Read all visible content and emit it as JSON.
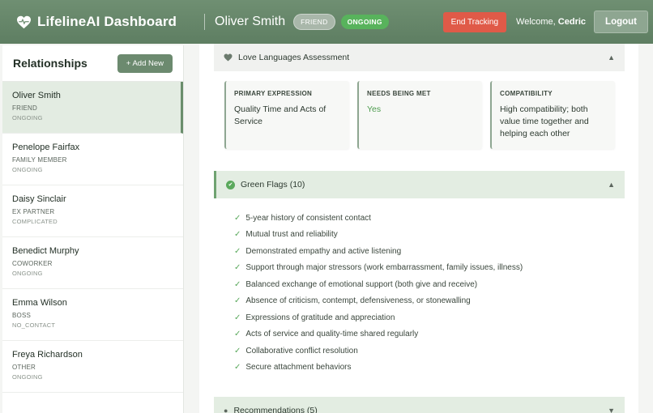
{
  "header": {
    "title": "LifelineAI Dashboard",
    "contact_name": "Oliver Smith",
    "relation_badge": "FRIEND",
    "status_badge": "ONGOING",
    "end_tracking_label": "End Tracking",
    "welcome_prefix": "Welcome, ",
    "user_name": "Cedric",
    "logout_label": "Logout"
  },
  "sidebar": {
    "title": "Relationships",
    "add_label": "+ Add New",
    "items": [
      {
        "name": "Oliver Smith",
        "type": "FRIEND",
        "status": "ONGOING"
      },
      {
        "name": "Penelope Fairfax",
        "type": "FAMILY MEMBER",
        "status": "ONGOING"
      },
      {
        "name": "Daisy Sinclair",
        "type": "EX PARTNER",
        "status": "COMPLICATED"
      },
      {
        "name": "Benedict Murphy",
        "type": "COWORKER",
        "status": "ONGOING"
      },
      {
        "name": "Emma Wilson",
        "type": "BOSS",
        "status": "NO_CONTACT"
      },
      {
        "name": "Freya Richardson",
        "type": "OTHER",
        "status": "ONGOING"
      }
    ]
  },
  "love_languages": {
    "title": "Love Languages Assessment",
    "cards": [
      {
        "label": "PRIMARY EXPRESSION",
        "value": "Quality Time and Acts of Service"
      },
      {
        "label": "NEEDS BEING MET",
        "value": "Yes"
      },
      {
        "label": "COMPATIBILITY",
        "value": "High compatibility; both value time together and helping each other"
      }
    ]
  },
  "green_flags": {
    "title": "Green Flags (10)",
    "items": [
      "5-year history of consistent contact",
      "Mutual trust and reliability",
      "Demonstrated empathy and active listening",
      "Support through major stressors (work embarrassment, family issues, illness)",
      "Balanced exchange of emotional support (both give and receive)",
      "Absence of criticism, contempt, defensiveness, or stonewalling",
      "Expressions of gratitude and appreciation",
      "Acts of service and quality-time shared regularly",
      "Collaborative conflict resolution",
      "Secure attachment behaviors"
    ]
  },
  "recommendations": {
    "title": "Recommendations (5)"
  },
  "colors": {
    "header_bg": "#6f8f72",
    "danger": "#e05a48",
    "success": "#58b35c",
    "accent": "#6a8d6c"
  }
}
